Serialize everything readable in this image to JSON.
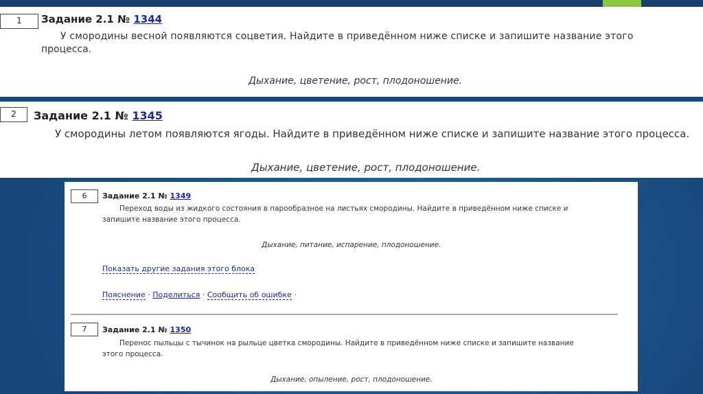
{
  "tasks": [
    {
      "num": "1",
      "title_prefix": "Задание 2.1 № ",
      "id": "1344",
      "line1": "У смородины весной появляются соцветия. Найдите в приведённом ниже списке и запишите название этого",
      "line2": "процесса.",
      "options": "Дыхание, цветение, рост, плодоношение."
    },
    {
      "num": "2",
      "title_prefix": "Задание 2.1 № ",
      "id": "1345",
      "line1": "У смородины летом появляются ягоды. Найдите в приведённом ниже списке и запишите название этого процесса.",
      "options": "Дыхание, цветение, рост, плодоношение."
    },
    {
      "num": "6",
      "title_prefix": "Задание 2.1 № ",
      "id": "1349",
      "line1": "Переход воды из жидкого состояния в парообразное на листьях смородины. Найдите в приведённом ниже списке и",
      "line2": "запишите название этого процесса.",
      "options": "Дыхание, питание, испарение, плодоношение."
    },
    {
      "num": "7",
      "title_prefix": "Задание 2.1 № ",
      "id": "1350",
      "line1": "Перенос пыльцы с тычинок на рыльце цветка смородины. Найдите в приведённом ниже списке и запишите название",
      "line2": "этого процесса.",
      "options": "Дыхание, опыление, рост, плодоношение."
    }
  ],
  "links": {
    "show_more": "Показать другие задания этого блока",
    "explanation": "Пояснение",
    "share": "Поделиться",
    "report": "Сообщить об ошибке",
    "dot": "·"
  },
  "colors": {
    "link": "#1b2b8f",
    "accent_green": "#8cc63f",
    "background": "#1c4f86"
  }
}
